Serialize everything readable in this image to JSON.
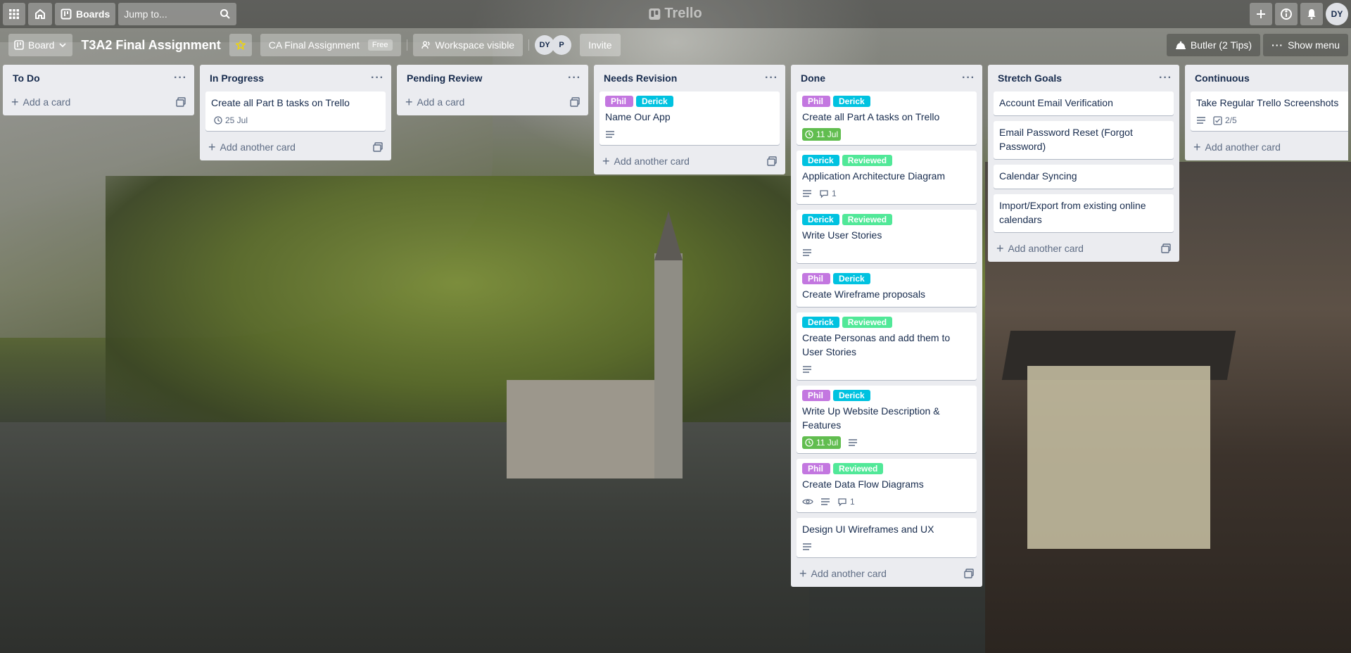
{
  "header": {
    "boards_label": "Boards",
    "search_placeholder": "Jump to...",
    "logo_text": "Trello",
    "user_initials": "DY"
  },
  "board": {
    "view_label": "Board",
    "title": "T3A2 Final Assignment",
    "workspace_label": "CA Final Assignment",
    "workspace_plan": "Free",
    "visibility_label": "Workspace visible",
    "members": [
      "DY",
      "P"
    ],
    "invite_label": "Invite",
    "butler_label": "Butler (2 Tips)",
    "show_menu_label": "Show menu"
  },
  "colors": {
    "label_purple": "#c377e0",
    "label_sky": "#00c2e0",
    "label_green": "#51e898",
    "due_complete": "#61bd4f"
  },
  "lists": [
    {
      "title": "To Do",
      "cards": [],
      "add_label": "Add a card"
    },
    {
      "title": "In Progress",
      "cards": [
        {
          "title": "Create all Part B tasks on Trello",
          "due": "25 Jul"
        }
      ],
      "add_label": "Add another card"
    },
    {
      "title": "Pending Review",
      "cards": [],
      "add_label": "Add a card"
    },
    {
      "title": "Needs Revision",
      "cards": [
        {
          "labels": [
            "Phil",
            "Derick"
          ],
          "title": "Name Our App"
        }
      ],
      "add_label": "Add another card"
    },
    {
      "title": "Done",
      "cards": [
        {
          "labels": [
            "Phil",
            "Derick"
          ],
          "title": "Create all Part A tasks on Trello",
          "due": "11 Jul"
        },
        {
          "labels": [
            "Derick",
            "Reviewed"
          ],
          "title": "Application Architecture Diagram",
          "comments": "1"
        },
        {
          "labels": [
            "Derick",
            "Reviewed"
          ],
          "title": "Write User Stories"
        },
        {
          "labels": [
            "Phil",
            "Derick"
          ],
          "title": "Create Wireframe proposals"
        },
        {
          "labels": [
            "Derick",
            "Reviewed"
          ],
          "title": "Create Personas and add them to User Stories"
        },
        {
          "labels": [
            "Phil",
            "Derick"
          ],
          "title": "Write Up Website Description & Features",
          "due": "11 Jul"
        },
        {
          "labels": [
            "Phil",
            "Reviewed"
          ],
          "title": "Create Data Flow Diagrams",
          "comments": "1"
        },
        {
          "title": "Design UI Wireframes and UX"
        }
      ],
      "add_label": "Add another card"
    },
    {
      "title": "Stretch Goals",
      "cards": [
        {
          "title": "Account Email Verification"
        },
        {
          "title": "Email Password Reset (Forgot Password)"
        },
        {
          "title": "Calendar Syncing"
        },
        {
          "title": "Import/Export from existing online calendars"
        }
      ],
      "add_label": "Add another card"
    },
    {
      "title": "Continuous",
      "cards": [
        {
          "title": "Take Regular Trello Screenshots",
          "checklist": "2/5"
        }
      ],
      "add_label": "Add another card"
    }
  ]
}
